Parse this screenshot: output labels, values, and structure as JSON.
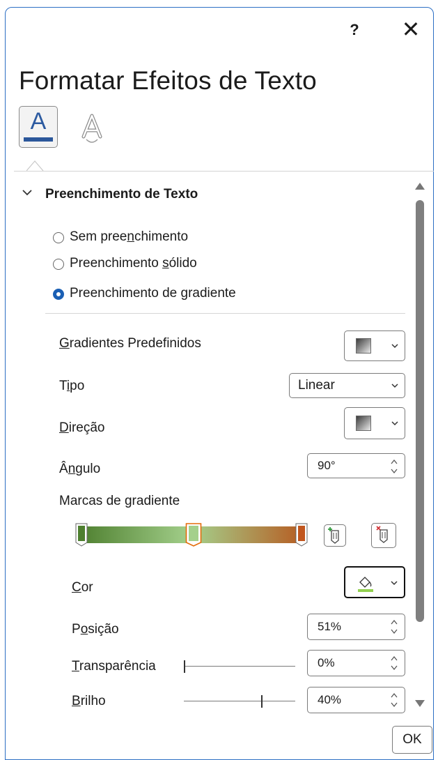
{
  "window": {
    "title": "Formatar Efeitos de Texto",
    "help_label": "?",
    "close_label": "✕"
  },
  "tabs": [
    {
      "icon": "text-fill-outline-icon",
      "label": "A"
    },
    {
      "icon": "text-effects-icon",
      "label": "A"
    }
  ],
  "section": {
    "title": "Preenchimento de Texto",
    "expanded": true
  },
  "fill_options": [
    {
      "pre": "Sem pree",
      "key": "n",
      "post": "chimento",
      "selected": false
    },
    {
      "pre": "Preenchimento ",
      "key": "s",
      "post": "ólido",
      "selected": false
    },
    {
      "pre": "Preenchimento de ",
      "key": "g",
      "post": "radiente",
      "selected": true
    }
  ],
  "gradient": {
    "presets": {
      "pre": "",
      "key": "G",
      "post": "radientes Predefinidos"
    },
    "type": {
      "pre": "T",
      "key": "i",
      "post": "po",
      "value": "Linear"
    },
    "direction": {
      "pre": "",
      "key": "D",
      "post": "ireção"
    },
    "angle": {
      "pre": "Â",
      "key": "n",
      "post": "gulo",
      "value": "90°"
    },
    "stops_label": "Marcas de gradiente",
    "stops": [
      {
        "position": 0,
        "color": "#4e7f2f",
        "selected": false
      },
      {
        "position": 51,
        "color": "#a4d08c",
        "selected": true
      },
      {
        "position": 100,
        "color": "#c1561e",
        "selected": false
      }
    ],
    "color": {
      "pre": "",
      "key": "C",
      "post": "or",
      "value_color": "#92d050"
    },
    "position": {
      "pre": "P",
      "key": "o",
      "post": "sição",
      "value": "51%"
    },
    "transparency": {
      "pre": "",
      "key": "T",
      "post": "ransparência",
      "value": "0%",
      "level": 0
    },
    "brightness": {
      "pre": "",
      "key": "B",
      "post": "rilho",
      "value": "40%",
      "level": 0.7
    }
  },
  "buttons": {
    "ok": "OK",
    "add_stop": "add-gradient-stop-icon",
    "remove_stop": "remove-gradient-stop-icon"
  },
  "colors": {
    "accent": "#1a5fb4",
    "selected_stop_border": "#e36c09",
    "window_border": "#2c6fc4"
  }
}
